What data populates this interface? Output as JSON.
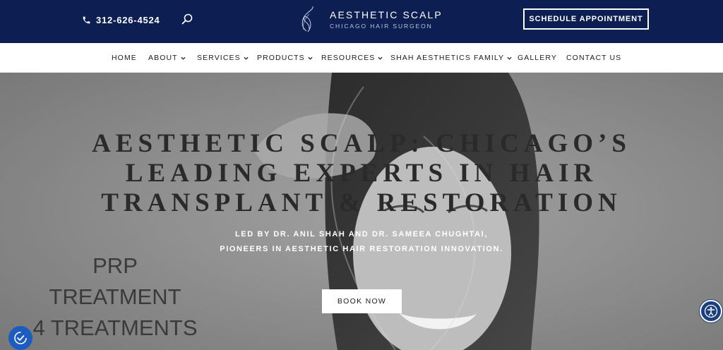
{
  "header": {
    "phone": "312-626-4524",
    "logo_title": "AESTHETIC SCALP",
    "logo_subtitle": "CHICAGO HAIR SURGEON",
    "schedule_button": "SCHEDULE APPOINTMENT",
    "background_color": "#0d1f52"
  },
  "nav": {
    "items": [
      {
        "label": "HOME",
        "has_dropdown": false
      },
      {
        "label": "ABOUT",
        "has_dropdown": true
      },
      {
        "label": "SERVICES",
        "has_dropdown": true
      },
      {
        "label": "PRODUCTS",
        "has_dropdown": true
      },
      {
        "label": "RESOURCES",
        "has_dropdown": true
      },
      {
        "label": "SHAH AESTHETICS FAMILY",
        "has_dropdown": true
      },
      {
        "label": "GALLERY",
        "has_dropdown": false
      },
      {
        "label": "CONTACT US",
        "has_dropdown": false
      }
    ]
  },
  "hero": {
    "title_lines": [
      "AESTHETIC SCALP: CHICAGO’S",
      "LEADING EXPERTS IN HAIR",
      "TRANSPLANT & RESTORATION"
    ],
    "subtitle_lines": [
      "LED BY DR. ANIL SHAH AND DR. SAMEEA CHUGHTAI,",
      "PIONEERS IN AESTHETIC HAIR RESTORATION INNOVATION."
    ],
    "book_button": "BOOK NOW",
    "promo_lines": [
      "PRP",
      "TREATMENT",
      "4 TREATMENTS"
    ]
  },
  "widgets": {
    "accessibility_icon": "accessibility-icon",
    "consent_icon": "cookie-consent-icon",
    "accessibility_color": "#1b3f7c",
    "consent_color": "#1c5bbf"
  }
}
